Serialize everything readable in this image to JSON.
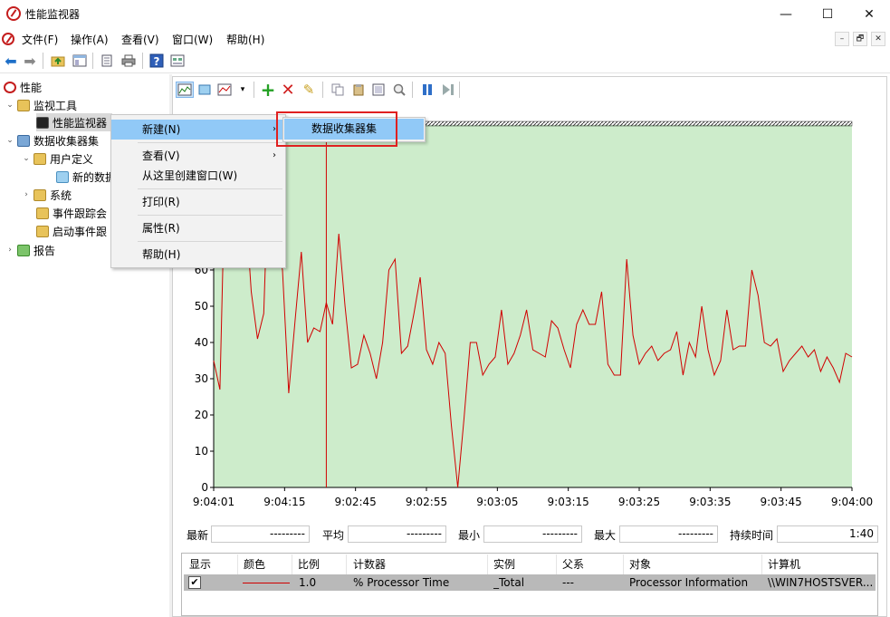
{
  "window": {
    "title": "性能监视器",
    "controls": {
      "minimize": "—",
      "maximize": "☐",
      "close": "✕"
    }
  },
  "menubar": [
    "文件(F)",
    "操作(A)",
    "查看(V)",
    "窗口(W)",
    "帮助(H)"
  ],
  "mdi_controls": [
    "–",
    "🗗",
    "✕"
  ],
  "toolbar_icons": [
    "back-icon",
    "forward-icon",
    "up-folder-icon",
    "show-hide-tree-icon",
    "export-list-icon",
    "print-icon",
    "help-icon",
    "properties-icon"
  ],
  "tree": {
    "root": "性能",
    "monitor_tools": "监视工具",
    "perf_monitor": "性能监视器",
    "collector_sets": "数据收集器集",
    "user_defined": "用户定义",
    "new_data": "新的数据",
    "system": "系统",
    "event_trace": "事件跟踪会",
    "startup_event": "启动事件跟",
    "reports": "报告"
  },
  "context_menu": {
    "new": "新建(N)",
    "view": "查看(V)",
    "new_window": "从这里创建窗口(W)",
    "print": "打印(R)",
    "properties": "属性(R)",
    "help": "帮助(H)"
  },
  "submenu": {
    "data_collector_set": "数据收集器集"
  },
  "graph_toolbar_icons": [
    "view-graph-icon",
    "freeze-display-icon",
    "change-graph-type-icon",
    "add-counter-icon",
    "delete-counter-icon",
    "highlight-icon",
    "copy-properties-icon",
    "paste-counter-list-icon",
    "properties-icon",
    "zoom-icon",
    "pause-icon",
    "update-data-icon"
  ],
  "stats": {
    "last_label": "最新",
    "last_value": "---------",
    "avg_label": "平均",
    "avg_value": "---------",
    "min_label": "最小",
    "min_value": "---------",
    "max_label": "最大",
    "max_value": "---------",
    "duration_label": "持续时间",
    "duration_value": "1:40"
  },
  "counter_table": {
    "headers": [
      "显示",
      "颜色",
      "比例",
      "计数器",
      "实例",
      "父系",
      "对象",
      "计算机"
    ],
    "row": {
      "show": "✔",
      "scale": "1.0",
      "counter": "% Processor Time",
      "instance": "_Total",
      "parent": "---",
      "object": "Processor Information",
      "computer": "\\\\WIN7HOSTSVER..."
    }
  },
  "colors": {
    "plot_bg": "#cdeccb",
    "series": "#d00000",
    "highlight": "#91c9f7",
    "callout": "#e02020"
  },
  "chart_data": {
    "type": "line",
    "ylim": [
      0,
      100
    ],
    "y_ticks": [
      "0",
      "10",
      "20",
      "30",
      "40",
      "50",
      "60"
    ],
    "x_ticks": [
      "9:04:01",
      "9:04:15",
      "9:02:45",
      "9:02:55",
      "9:03:05",
      "9:03:15",
      "9:03:25",
      "9:03:35",
      "9:03:45",
      "9:04:00"
    ],
    "series": [
      {
        "values": [
          35,
          27,
          100,
          100,
          99,
          80,
          54,
          41,
          48,
          100,
          69,
          60,
          26,
          46,
          65,
          40,
          44,
          43,
          51,
          45,
          70,
          50,
          33,
          34,
          42,
          37,
          30,
          40,
          60,
          63,
          37,
          39,
          48,
          58,
          38,
          34,
          40,
          37,
          17,
          0,
          19,
          40,
          40,
          31,
          34,
          36,
          49,
          34,
          37,
          42,
          49,
          38,
          37,
          36,
          46,
          44,
          38,
          33,
          45,
          49,
          45,
          45,
          54,
          34,
          31,
          31,
          63,
          42,
          34,
          37,
          39,
          35,
          37,
          38,
          43,
          31,
          40,
          36,
          50,
          38,
          31,
          35,
          49,
          38,
          39,
          39,
          60,
          53,
          40,
          39,
          41,
          32,
          35,
          37,
          39,
          36,
          38,
          32,
          36,
          33,
          29,
          37,
          36
        ]
      }
    ]
  }
}
